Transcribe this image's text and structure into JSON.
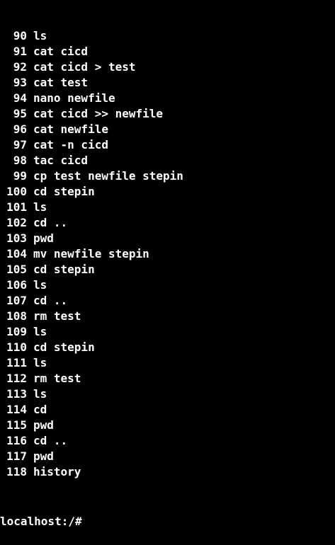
{
  "terminal": {
    "history": [
      {
        "num": "90",
        "cmd": "ls"
      },
      {
        "num": "91",
        "cmd": "cat cicd"
      },
      {
        "num": "92",
        "cmd": "cat cicd > test"
      },
      {
        "num": "93",
        "cmd": "cat test"
      },
      {
        "num": "94",
        "cmd": "nano newfile"
      },
      {
        "num": "95",
        "cmd": "cat cicd >> newfile"
      },
      {
        "num": "96",
        "cmd": "cat newfile"
      },
      {
        "num": "97",
        "cmd": "cat -n cicd"
      },
      {
        "num": "98",
        "cmd": "tac cicd"
      },
      {
        "num": "99",
        "cmd": "cp test newfile stepin"
      },
      {
        "num": "100",
        "cmd": "cd stepin"
      },
      {
        "num": "101",
        "cmd": "ls"
      },
      {
        "num": "102",
        "cmd": "cd .."
      },
      {
        "num": "103",
        "cmd": "pwd"
      },
      {
        "num": "104",
        "cmd": "mv newfile stepin"
      },
      {
        "num": "105",
        "cmd": "cd stepin"
      },
      {
        "num": "106",
        "cmd": "ls"
      },
      {
        "num": "107",
        "cmd": "cd .."
      },
      {
        "num": "108",
        "cmd": "rm test"
      },
      {
        "num": "109",
        "cmd": "ls"
      },
      {
        "num": "110",
        "cmd": "cd stepin"
      },
      {
        "num": "111",
        "cmd": "ls"
      },
      {
        "num": "112",
        "cmd": "rm test"
      },
      {
        "num": "113",
        "cmd": "ls"
      },
      {
        "num": "114",
        "cmd": "cd"
      },
      {
        "num": "115",
        "cmd": "pwd"
      },
      {
        "num": "116",
        "cmd": "cd .."
      },
      {
        "num": "117",
        "cmd": "pwd"
      },
      {
        "num": "118",
        "cmd": "history"
      }
    ],
    "prompt": "localhost:/#",
    "colors": {
      "background": "#000000",
      "foreground": "#ffffff"
    }
  }
}
